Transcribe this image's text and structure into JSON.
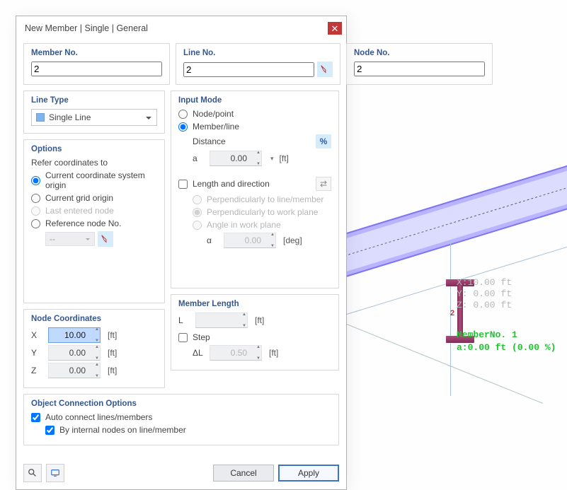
{
  "title": "New Member | Single | General",
  "top": {
    "member_no": {
      "label": "Member No.",
      "value": "2"
    },
    "line_no": {
      "label": "Line No.",
      "value": "2"
    },
    "node_no": {
      "label": "Node No.",
      "value": "2"
    }
  },
  "line_type": {
    "header": "Line Type",
    "value": "Single Line"
  },
  "options": {
    "header": "Options",
    "refer_label": "Refer coordinates to",
    "csys": "Current coordinate system origin",
    "grid": "Current grid origin",
    "last": "Last entered node",
    "refn": "Reference node No.",
    "refn_value": "--",
    "selected": "csys"
  },
  "input_mode": {
    "header": "Input Mode",
    "node_point": "Node/point",
    "member_line": "Member/line",
    "selected": "member_line",
    "distance_label": "Distance",
    "a_label": "a",
    "a_value": "0.00",
    "a_unit": "[ft]",
    "pct_label": "%",
    "len_dir": "Length and direction",
    "perp_line": "Perpendicularly to line/member",
    "perp_plane": "Perpendicularly to work plane",
    "angle": "Angle in work plane",
    "alpha_label": "α",
    "alpha_value": "0.00",
    "alpha_unit": "[deg]"
  },
  "coords": {
    "header": "Node Coordinates",
    "x": {
      "label": "X",
      "value": "10.00",
      "unit": "[ft]"
    },
    "y": {
      "label": "Y",
      "value": "0.00",
      "unit": "[ft]"
    },
    "z": {
      "label": "Z",
      "value": "0.00",
      "unit": "[ft]"
    }
  },
  "mlen": {
    "header": "Member Length",
    "l": {
      "label": "L",
      "value": "",
      "unit": "[ft]"
    },
    "step_label": "Step",
    "dl": {
      "label": "ΔL",
      "value": "0.50",
      "unit": "[ft]"
    }
  },
  "conn": {
    "header": "Object Connection Options",
    "auto": "Auto connect lines/members",
    "internal": "By internal nodes on line/member"
  },
  "buttons": {
    "cancel": "Cancel",
    "apply": "Apply"
  },
  "viewport": {
    "node_label": "2",
    "coord_text": "X:10.00 ft\nY: 0.00 ft\nZ: 0.00 ft",
    "member_text": "MemberNo. 1\na:0.00 ft (0.00 %)"
  }
}
